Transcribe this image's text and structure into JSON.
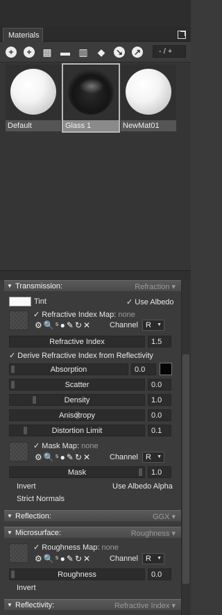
{
  "tab": {
    "label": "Materials"
  },
  "toolbar": {
    "pager": "- / +"
  },
  "materials": [
    {
      "name": "Default",
      "selected": false
    },
    {
      "name": "Glass 1",
      "selected": true
    },
    {
      "name": "NewMat01",
      "selected": false
    }
  ],
  "transmission": {
    "header": "Transmission:",
    "mode": "Refraction",
    "tint_label": "Tint",
    "use_albedo": "Use Albedo",
    "ri_map_label": "Refractive Index Map:",
    "ri_map_value": "none",
    "channel_label": "Channel",
    "channel_value": "R",
    "ri_label": "Refractive Index",
    "ri_value": "1.5",
    "derive_label": "Derive Refractive Index from Reflectivity",
    "absorption_label": "Absorption",
    "absorption_value": "0.0",
    "scatter_label": "Scatter",
    "scatter_value": "0.0",
    "density_label": "Density",
    "density_value": "1.0",
    "anisotropy_label": "Anisotropy",
    "anisotropy_value": "0.0",
    "distortion_label": "Distortion Limit",
    "distortion_value": "0.1",
    "mask_map_label": "Mask Map:",
    "mask_map_value": "none",
    "mask_channel_value": "R",
    "mask_label": "Mask",
    "mask_value": "1.0",
    "invert_label": "Invert",
    "use_albedo_alpha": "Use Albedo Alpha",
    "strict_normals": "Strict Normals"
  },
  "reflection": {
    "header": "Reflection:",
    "mode": "GGX"
  },
  "microsurface": {
    "header": "Microsurface:",
    "mode": "Roughness",
    "map_label": "Roughness Map:",
    "map_value": "none",
    "channel_label": "Channel",
    "channel_value": "R",
    "roughness_label": "Roughness",
    "roughness_value": "0.0",
    "invert_label": "Invert"
  },
  "reflectivity": {
    "header": "Reflectivity:",
    "mode": "Refractive Index"
  },
  "tool_icons": "⚙🔍⁵●✎↻✕"
}
